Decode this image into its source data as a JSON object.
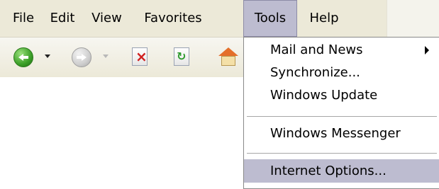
{
  "menubar": {
    "items": [
      {
        "label": "File"
      },
      {
        "label": "Edit"
      },
      {
        "label": "View"
      },
      {
        "label": "Favorites"
      },
      {
        "label": "Tools",
        "active": true
      },
      {
        "label": "Help"
      }
    ]
  },
  "toolbar": {
    "buttons": [
      {
        "icon": "back-icon"
      },
      {
        "icon": "forward-icon"
      },
      {
        "icon": "stop-icon"
      },
      {
        "icon": "refresh-icon"
      },
      {
        "icon": "home-icon"
      }
    ]
  },
  "tools_menu": {
    "items": [
      {
        "label": "Mail and News",
        "has_submenu": true
      },
      {
        "label": "Synchronize..."
      },
      {
        "label": "Windows Update"
      },
      {
        "label": "Windows Messenger"
      },
      {
        "label": "Internet Options...",
        "highlighted": true
      }
    ]
  },
  "colors": {
    "menubar_bg": "#ece9d8",
    "highlight": "#bdbcd0"
  }
}
